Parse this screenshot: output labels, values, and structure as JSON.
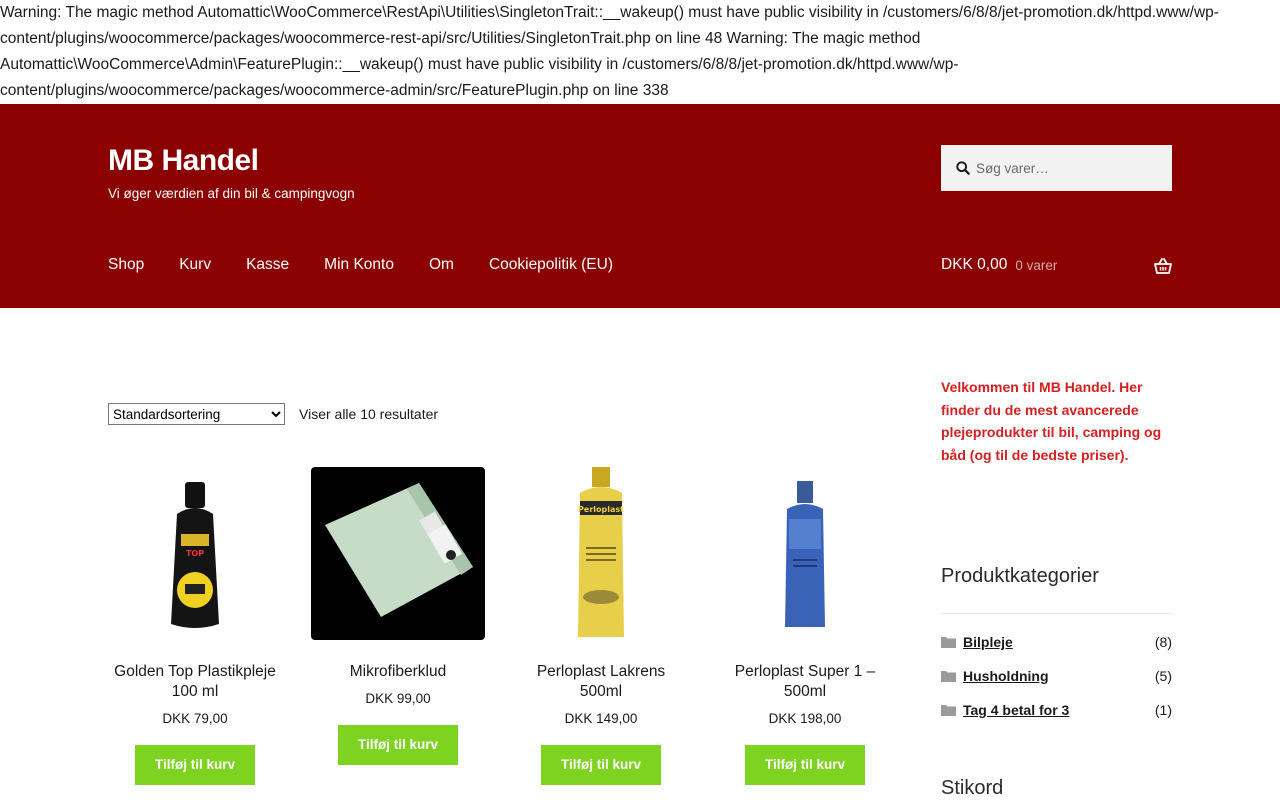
{
  "warning": {
    "text": "Warning: The magic method Automattic\\WooCommerce\\RestApi\\Utilities\\SingletonTrait::__wakeup() must have public visibility in /customers/6/8/8/jet-promotion.dk/httpd.www/wp-content/plugins/woocommerce/packages/woocommerce-rest-api/src/Utilities/SingletonTrait.php on line 48 Warning: The magic method Automattic\\WooCommerce\\Admin\\FeaturePlugin::__wakeup() must have public visibility in /customers/6/8/8/jet-promotion.dk/httpd.www/wp-content/plugins/woocommerce/packages/woocommerce-admin/src/FeaturePlugin.php on line 338"
  },
  "header": {
    "site_title": "MB Handel",
    "tagline": "Vi øger værdien af din bil & campingvogn",
    "search_placeholder": "Søg varer…",
    "nav": [
      "Shop",
      "Kurv",
      "Kasse",
      "Min Konto",
      "Om",
      "Cookiepolitik (EU)"
    ],
    "cart_amount": "DKK 0,00",
    "cart_count": "0 varer",
    "bg_color": "#8b0000"
  },
  "shop": {
    "ordering_selected": "Standardsortering",
    "result_count": "Viser alle 10 resultater",
    "button_color": "#7ed321",
    "products": [
      {
        "name": "Golden Top Plastikpleje 100 ml",
        "price": "DKK 79,00",
        "button": "Tilføj til kurv",
        "image_icon": "black-bottle-image"
      },
      {
        "name": "Mikrofiberklud",
        "price": "DKK 99,00",
        "button": "Tilføj til kurv",
        "image_icon": "microfiber-cloth-image"
      },
      {
        "name": "Perloplast Lakrens 500ml",
        "price": "DKK 149,00",
        "button": "Tilføj til kurv",
        "image_icon": "yellow-bottle-image"
      },
      {
        "name": "Perloplast Super 1 – 500ml",
        "price": "DKK 198,00",
        "button": "Tilføj til kurv",
        "image_icon": "blue-bottle-image"
      }
    ]
  },
  "sidebar": {
    "welcome": "Velkommen til MB Handel. Her finder du de mest avancerede plejeprodukter til bil, camping og båd (og til de bedste priser).",
    "categories_title": "Produktkategorier",
    "categories": [
      {
        "name": "Bilpleje",
        "count": "(8)"
      },
      {
        "name": "Husholdning",
        "count": "(5)"
      },
      {
        "name": "Tag 4 betal for 3",
        "count": "(1)"
      }
    ],
    "tags_title": "Stikord"
  }
}
